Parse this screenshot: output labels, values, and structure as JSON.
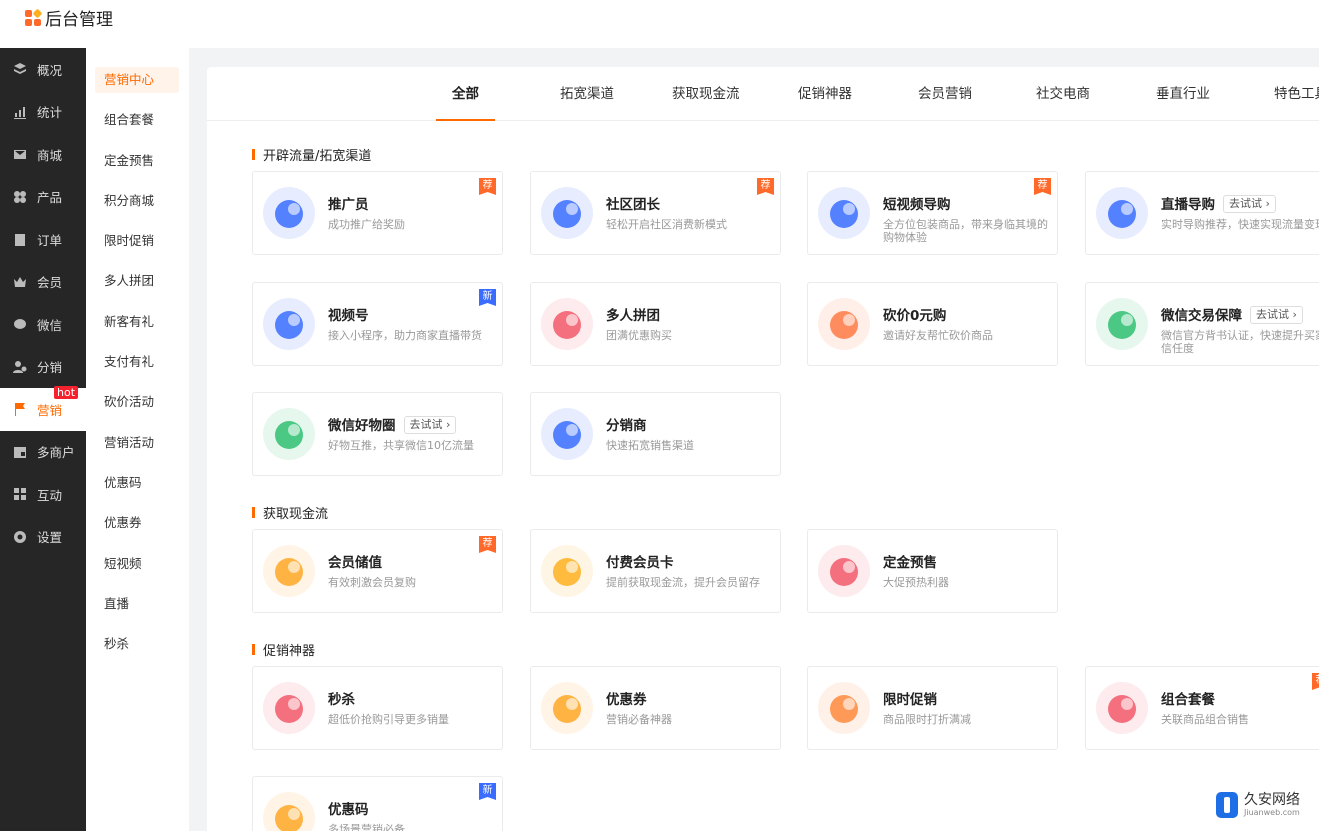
{
  "app": {
    "title": "后台管理"
  },
  "side1": [
    {
      "label": "概况",
      "icon": "layers-icon"
    },
    {
      "label": "统计",
      "icon": "chart-icon"
    },
    {
      "label": "商城",
      "icon": "mail-icon"
    },
    {
      "label": "产品",
      "icon": "grid-icon"
    },
    {
      "label": "订单",
      "icon": "clipboard-icon"
    },
    {
      "label": "会员",
      "icon": "crown-icon"
    },
    {
      "label": "微信",
      "icon": "wechat-icon"
    },
    {
      "label": "分销",
      "icon": "users-icon"
    },
    {
      "label": "营销",
      "icon": "flag-icon",
      "badge": "hot"
    },
    {
      "label": "多商户",
      "icon": "store-icon"
    },
    {
      "label": "互动",
      "icon": "grid2-icon"
    },
    {
      "label": "设置",
      "icon": "gear-icon"
    }
  ],
  "side2": [
    "营销中心",
    "组合套餐",
    "定金预售",
    "积分商城",
    "限时促销",
    "多人拼团",
    "新客有礼",
    "支付有礼",
    "砍价活动",
    "营销活动",
    "优惠码",
    "优惠券",
    "短视频",
    "直播",
    "秒杀"
  ],
  "tabs": [
    "全部",
    "拓宽渠道",
    "获取现金流",
    "促销神器",
    "会员营销",
    "社交电商",
    "垂直行业",
    "特色工具"
  ],
  "sections": [
    {
      "title": "开辟流量/拓宽渠道"
    },
    {
      "title": "获取现金流"
    },
    {
      "title": "促销神器"
    }
  ],
  "cards": [
    {
      "title": "推广员",
      "desc": "成功推广给奖励",
      "badge": "荐",
      "icon": "megaphone-icon",
      "color": "#3a6dff"
    },
    {
      "title": "社区团长",
      "desc": "轻松开启社区消费新模式",
      "badge": "荐",
      "icon": "community-leader-icon",
      "color": "#3a6dff"
    },
    {
      "title": "短视频导购",
      "desc": "全方位包装商品，带来身临其境的购物体验",
      "badge": "荐",
      "icon": "shopping-bag-icon",
      "color": "#3a6dff"
    },
    {
      "title": "直播导购",
      "try": "去试试 ›",
      "desc": "实时导购推荐，快速实现流量变现",
      "icon": "clapper-icon",
      "color": "#3a6dff"
    },
    {
      "title": "视频号",
      "desc": "接入小程序，助力商家直播带货",
      "badge": "新",
      "icon": "video-channel-icon",
      "color": "#3a6dff"
    },
    {
      "title": "多人拼团",
      "desc": "团满优惠购买",
      "icon": "group-buy-icon",
      "color": "#f25a6a"
    },
    {
      "title": "砍价0元购",
      "desc": "邀请好友帮忙砍价商品",
      "icon": "price-tag-icon",
      "color": "#ff7a45"
    },
    {
      "title": "微信交易保障",
      "try": "去试试 ›",
      "desc": "微信官方背书认证，快速提升买家信任度",
      "icon": "shield-icon",
      "color": "#2fbf71"
    },
    {
      "title": "微信好物圈",
      "try": "去试试 ›",
      "desc": "好物互推，共享微信10亿流量",
      "icon": "sprout-icon",
      "color": "#2fbf71"
    },
    {
      "title": "分销商",
      "desc": "快速拓宽销售渠道",
      "icon": "distributor-icon",
      "color": "#3a6dff"
    },
    {
      "title": "会员储值",
      "desc": "有效刺激会员复购",
      "badge": "荐",
      "icon": "coin-icon",
      "color": "#ffa726"
    },
    {
      "title": "付费会员卡",
      "desc": "提前获取现金流，提升会员留存",
      "icon": "vip-card-icon",
      "color": "#ffb020"
    },
    {
      "title": "定金预售",
      "desc": "大促预热利器",
      "icon": "piggy-bank-icon",
      "color": "#f25a6a"
    },
    {
      "title": "秒杀",
      "desc": "超低价抢购引导更多销量",
      "icon": "flash-sale-icon",
      "color": "#f25a6a"
    },
    {
      "title": "优惠券",
      "desc": "营销必备神器",
      "icon": "coupon-icon",
      "color": "#ffa726"
    },
    {
      "title": "限时促销",
      "desc": "商品限时打折满减",
      "icon": "discount-icon",
      "color": "#ff8a3d"
    },
    {
      "title": "组合套餐",
      "desc": "关联商品组合销售",
      "badge": "荐",
      "icon": "bundle-icon",
      "color": "#f25a6a"
    },
    {
      "title": "优惠码",
      "desc": "多场景营销必备",
      "badge": "新",
      "icon": "promo-code-icon",
      "color": "#ffa726"
    }
  ],
  "watermark": {
    "name": "久安网络",
    "url": "Jiuanweb.com"
  }
}
